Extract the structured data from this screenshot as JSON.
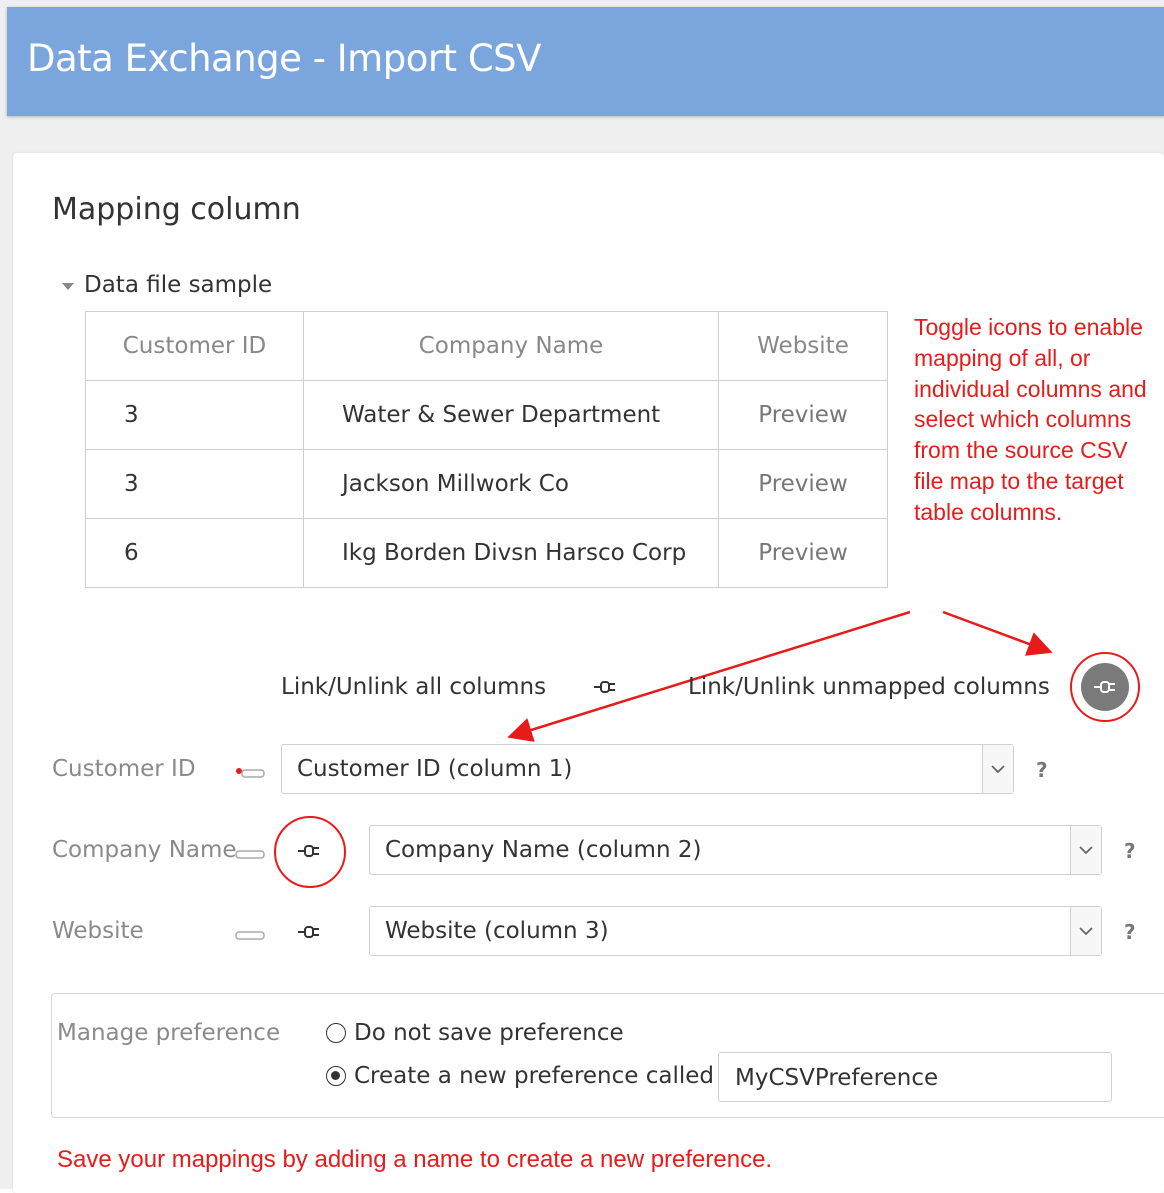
{
  "header": {
    "title": "Data Exchange - Import CSV"
  },
  "section": {
    "title": "Mapping column",
    "sample_toggle_label": "Data file sample"
  },
  "sample_table": {
    "columns": [
      "Customer ID",
      "Company Name",
      "Website"
    ],
    "rows": [
      [
        "3",
        "Water & Sewer Department",
        "Preview"
      ],
      [
        "3",
        "Jackson Millwork Co",
        "Preview"
      ],
      [
        "6",
        "Ikg Borden Divsn Harsco Corp",
        "Preview"
      ]
    ]
  },
  "annotation": {
    "text": "Toggle icons to enable mapping of all, or individual columns and select which columns from the source CSV file map to the target table columns.",
    "color": "#e81b1b"
  },
  "link_controls": {
    "all_label": "Link/Unlink all columns",
    "unmapped_label": "Link/Unlink unmapped columns",
    "icon": "plug-icon"
  },
  "mapping": {
    "fields": [
      {
        "label": "Customer ID",
        "icon": "key-icon",
        "value": "Customer ID (column 1)",
        "help": "?"
      },
      {
        "label": "Company Name",
        "icon": "key-icon",
        "value": "Company Name (column 2)",
        "help": "?"
      },
      {
        "label": "Website",
        "icon": "key-icon",
        "value": "Website (column 3)",
        "help": "?"
      }
    ]
  },
  "preference": {
    "label": "Manage preference",
    "options": [
      {
        "label": "Do not save preference",
        "selected": false
      },
      {
        "label": "Create a new preference called",
        "selected": true
      }
    ],
    "name_value": "MyCSVPreference"
  },
  "footer_note": "Save your mappings by adding a name to create a new preference.",
  "colors": {
    "header": "#7ba6dd",
    "annotation": "#e81b1b",
    "plug_active": "#7a7a7a"
  }
}
